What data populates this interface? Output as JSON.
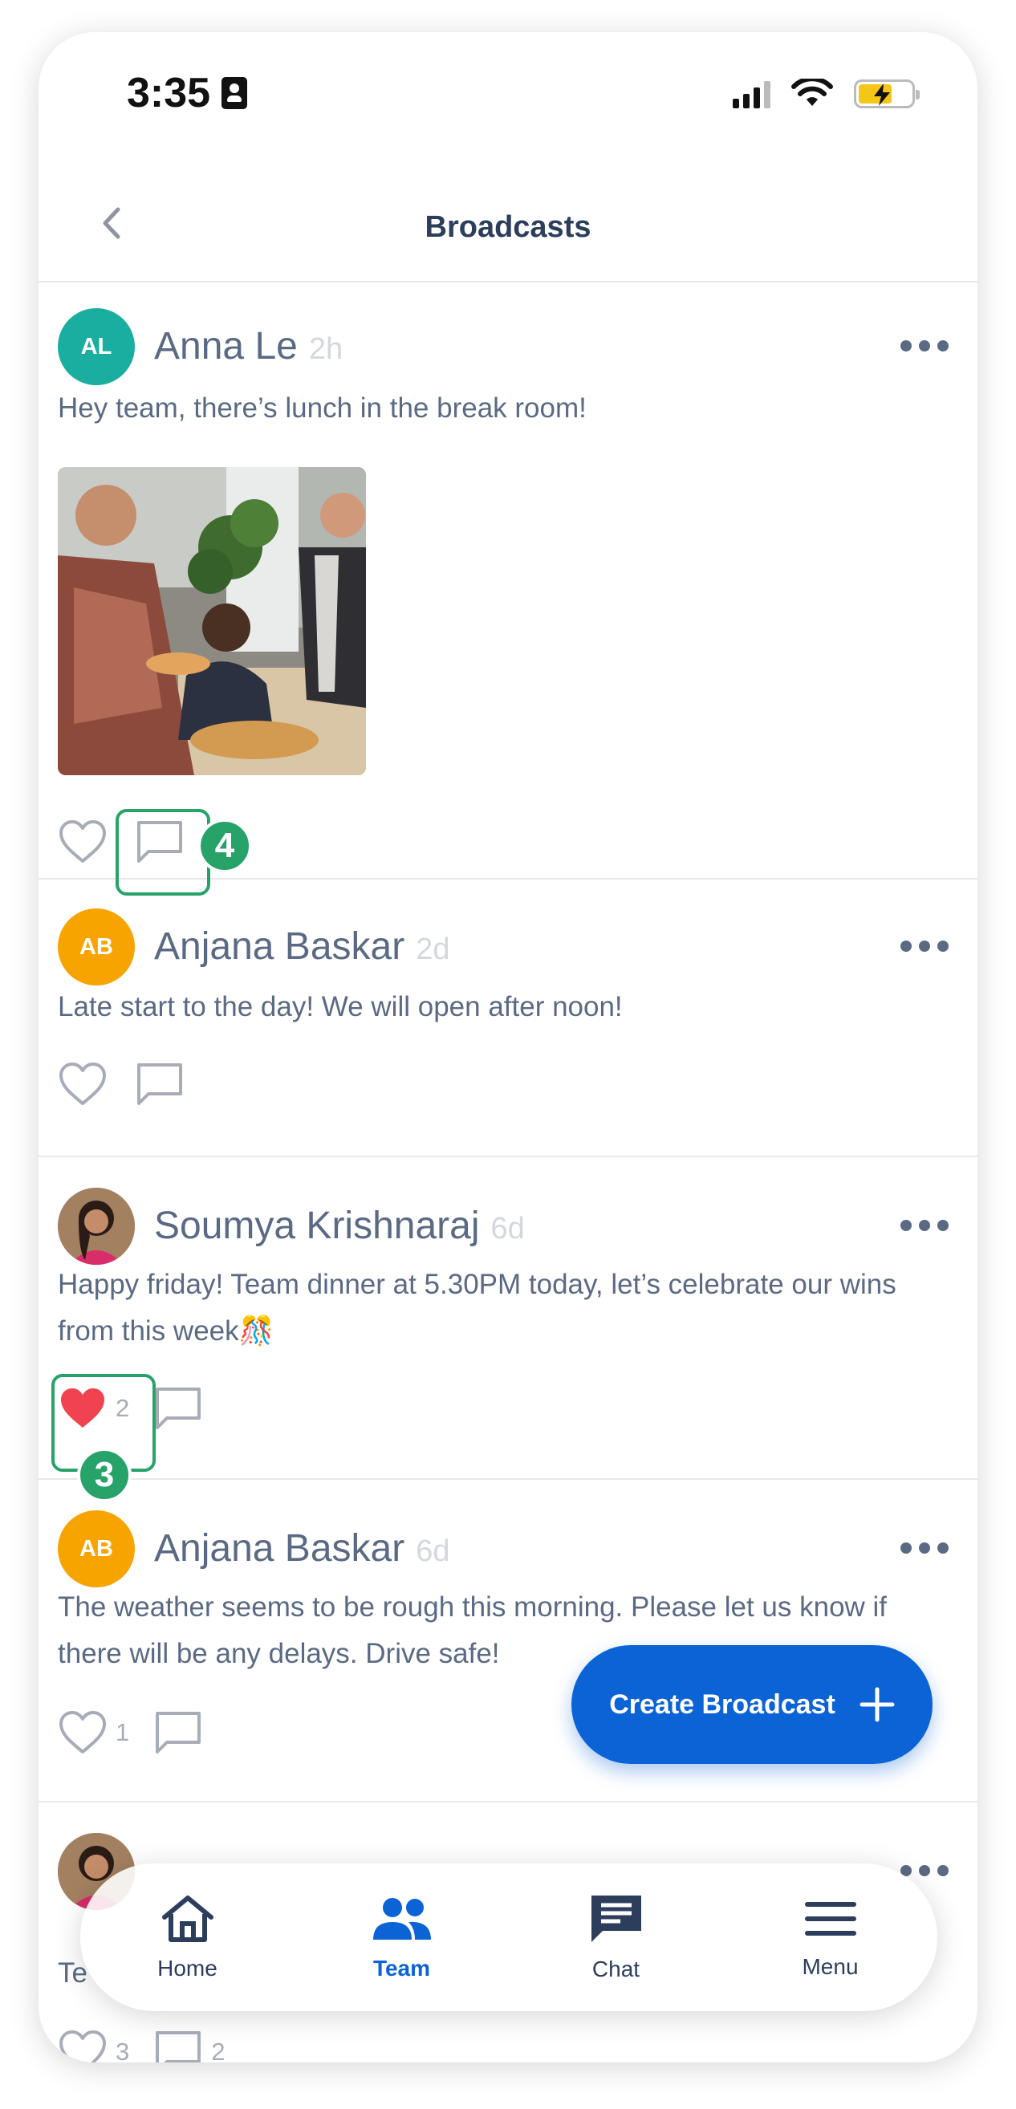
{
  "status_bar": {
    "time": "3:35"
  },
  "header": {
    "title": "Broadcasts"
  },
  "posts": [
    {
      "initials": "AL",
      "author": "Anna Le",
      "age": "2h",
      "text": "Hey team, there’s lunch in the break room!",
      "avatar_color": "#1aaea1",
      "has_photo": true,
      "likes": "",
      "comments": ""
    },
    {
      "initials": "AB",
      "author": "Anjana Baskar",
      "age": "2d",
      "text": "Late start to the day! We will open after noon!",
      "avatar_color": "#f7a400",
      "likes": "",
      "comments": ""
    },
    {
      "initials": "",
      "author": "Soumya Krishnaraj",
      "age": "6d",
      "text": "Happy friday! Team dinner at 5.30PM today, let’s celebrate our wins from this week🎊",
      "liked": true,
      "likes": "2",
      "comments": ""
    },
    {
      "initials": "AB",
      "author": "Anjana Baskar",
      "age": "6d",
      "text": "The weather seems to be rough this morning. Please let us know if there will be any delays. Drive safe!",
      "avatar_color": "#f7a400",
      "likes": "1",
      "comments": ""
    },
    {
      "initials": "",
      "author": "",
      "age": "",
      "text": "Te",
      "likes": "3",
      "comments": "2"
    }
  ],
  "annotations": [
    {
      "label": "4"
    },
    {
      "label": "3"
    }
  ],
  "fab": {
    "label": "Create Broadcast"
  },
  "nav": [
    {
      "label": "Home",
      "icon": "home-icon"
    },
    {
      "label": "Team",
      "icon": "team-icon",
      "active": true
    },
    {
      "label": "Chat",
      "icon": "chat-icon"
    },
    {
      "label": "Menu",
      "icon": "menu-icon"
    }
  ],
  "colors": {
    "accent": "#0b63d6",
    "annotation": "#27a36a",
    "like_red": "#f0424f",
    "text": "#5b6a84"
  }
}
